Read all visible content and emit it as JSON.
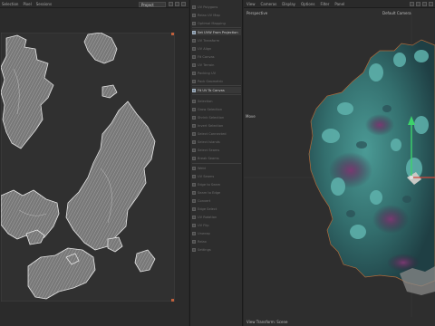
{
  "uv_editor": {
    "menus": [
      "Selection",
      "Pixel",
      "Sessions"
    ],
    "project_select": "Project",
    "toolbar_icons": [
      "view-toggle-icon",
      "snap-icon",
      "grid-icon"
    ]
  },
  "tool_panel": {
    "items": [
      {
        "label": "UV Polygons",
        "active": false
      },
      {
        "label": "Relax UV Map",
        "active": false
      },
      {
        "label": "Optimal Mapping",
        "active": false
      },
      {
        "label": "Set UVW From Projection",
        "active": true
      },
      {
        "label": "UV Transform",
        "active": false
      },
      {
        "label": "UV Align",
        "active": false
      },
      {
        "label": "Fit Canvas",
        "active": false
      },
      {
        "label": "UV Terrain",
        "active": false
      },
      {
        "label": "Packing UV",
        "active": false
      },
      {
        "label": "Pack Geometric",
        "active": false
      },
      {
        "label": "Fit UV To Canvas",
        "active": true
      },
      {
        "label": "Selection",
        "active": false
      },
      {
        "label": "Grow Selection",
        "active": false
      },
      {
        "label": "Shrink Selection",
        "active": false
      },
      {
        "label": "Invert Selection",
        "active": false
      },
      {
        "label": "Select Connected",
        "active": false
      },
      {
        "label": "Select Islands",
        "active": false
      },
      {
        "label": "Select Seams",
        "active": false
      },
      {
        "label": "Break Seams",
        "active": false
      },
      {
        "label": "Weld",
        "active": false
      },
      {
        "label": "UV Seams",
        "active": false
      },
      {
        "label": "Edge to Seam",
        "active": false
      },
      {
        "label": "Seam to Edge",
        "active": false
      },
      {
        "label": "Convert",
        "active": false
      },
      {
        "label": "Edge Select",
        "active": false
      },
      {
        "label": "UV Rotation",
        "active": false
      },
      {
        "label": "UV Flip",
        "active": false
      },
      {
        "label": "Unwrap",
        "active": false
      },
      {
        "label": "Relax",
        "active": false
      },
      {
        "label": "Settings",
        "active": false
      }
    ]
  },
  "viewport": {
    "menus": [
      "View",
      "Cameras",
      "Display",
      "Options",
      "Filter",
      "Panel"
    ],
    "projection_label": "Perspective",
    "camera_label": "Default Camera",
    "tool_label": "Move",
    "status_text": "View Transform: Scene"
  },
  "colors": {
    "mesh_teal": "#3f8f8b",
    "mesh_purple": "#6a2f63",
    "gizmo_green": "#3cd36a",
    "uv_island": "#8a8a8a"
  }
}
